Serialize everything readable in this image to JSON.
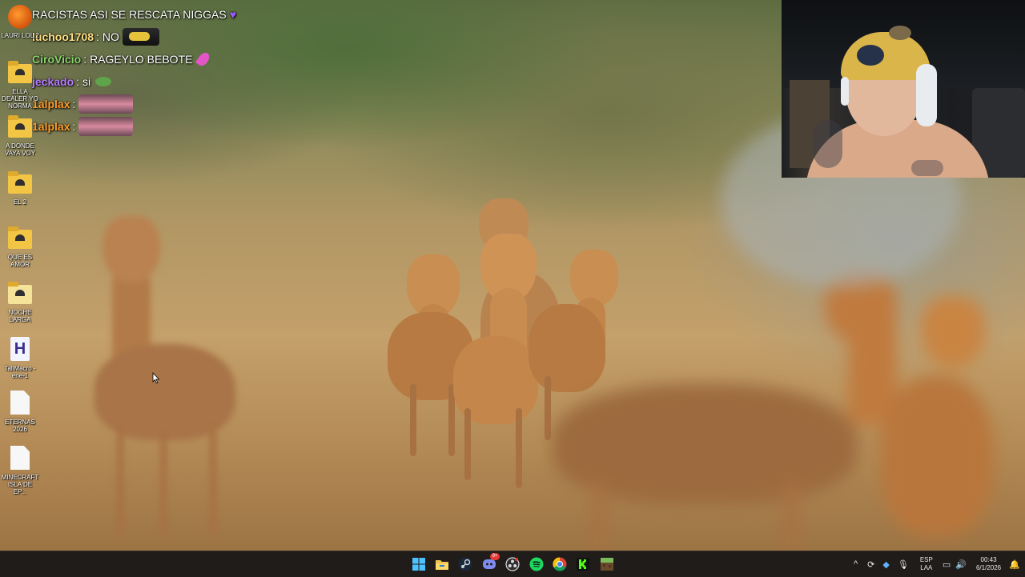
{
  "chat": {
    "messages": [
      {
        "user": "",
        "text": "RACISTAS ASI SE RESCATA NIGGAS",
        "emote": "purple-heart"
      },
      {
        "user": "luchoo1708",
        "sep": ":",
        "text": "NO",
        "user_color": "#ffe082",
        "emote": "car-emote"
      },
      {
        "user": "CiroVicio",
        "sep": ":",
        "text": "RAGEYLO BEBOTE",
        "user_color": "#8bd36b",
        "emote": "pink-feather"
      },
      {
        "user": "jeckado",
        "sep": ":",
        "text": "si",
        "user_color": "#b77cff",
        "emote": "green-frog"
      },
      {
        "user": "1alplax",
        "sep": ":",
        "text": "",
        "user_color": "#ff9e2c",
        "emote": "lips-emote"
      },
      {
        "user": "1alplax",
        "sep": ":",
        "text": "",
        "user_color": "#ff9e2c",
        "emote": "lips-emote"
      }
    ]
  },
  "desktop": {
    "icons": [
      {
        "name": "fl-studio-icon",
        "label": "LAURI LOL 2",
        "kind": "app"
      },
      {
        "name": "folder-icon",
        "label": "ELLA DEALER YO NORMA",
        "kind": "folder"
      },
      {
        "name": "folder-icon",
        "label": "A DONDE VAYA VOY",
        "kind": "folder"
      },
      {
        "name": "folder-icon",
        "label": "EL 2",
        "kind": "folder"
      },
      {
        "name": "folder-icon",
        "label": "QUE ES AMOR",
        "kind": "folder"
      },
      {
        "name": "folder-icon",
        "label": "NOCHE LARGA",
        "kind": "folder"
      },
      {
        "name": "h-file-icon",
        "label": "TallMacro - ene-1",
        "kind": "hfile"
      },
      {
        "name": "document-icon",
        "label": "ETERNAS 2026",
        "kind": "doc"
      },
      {
        "name": "document-icon",
        "label": "MINECRAFT ISLA DE EP...",
        "kind": "doc"
      }
    ]
  },
  "taskbar": {
    "apps": [
      {
        "name": "windows-start-icon",
        "color": "#4cc2ff"
      },
      {
        "name": "file-explorer-icon",
        "color": "#f2c14e"
      },
      {
        "name": "steam-icon",
        "color": "#c7d5e0"
      },
      {
        "name": "discord-icon",
        "color": "#7e8cf0",
        "badge": "9+"
      },
      {
        "name": "obs-icon",
        "color": "#dcdcdc"
      },
      {
        "name": "spotify-icon",
        "color": "#1ed760"
      },
      {
        "name": "chrome-icon",
        "color": "#f4c20d"
      },
      {
        "name": "kick-icon",
        "color": "#53fc18"
      },
      {
        "name": "minecraft-icon",
        "color": "#7dbb5a"
      }
    ],
    "tray": {
      "lang_top": "ESP",
      "lang_bottom": "LAA",
      "time": "00:43",
      "date": "6/1/2026"
    }
  }
}
